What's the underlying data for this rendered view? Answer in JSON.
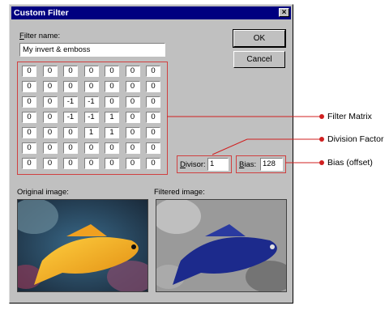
{
  "dialog": {
    "title": "Custom Filter",
    "filter_name_label": "Filter name:",
    "filter_name_value": "My invert & emboss",
    "ok_label": "OK",
    "cancel_label": "Cancel",
    "matrix": [
      [
        "0",
        "0",
        "0",
        "0",
        "0",
        "0",
        "0"
      ],
      [
        "0",
        "0",
        "0",
        "0",
        "0",
        "0",
        "0"
      ],
      [
        "0",
        "0",
        "-1",
        "-1",
        "0",
        "0",
        "0"
      ],
      [
        "0",
        "0",
        "-1",
        "-1",
        "1",
        "0",
        "0"
      ],
      [
        "0",
        "0",
        "0",
        "1",
        "1",
        "0",
        "0"
      ],
      [
        "0",
        "0",
        "0",
        "0",
        "0",
        "0",
        "0"
      ],
      [
        "0",
        "0",
        "0",
        "0",
        "0",
        "0",
        "0"
      ]
    ],
    "divisor_label": "Divisor:",
    "divisor_value": "1",
    "bias_label": "Bias:",
    "bias_value": "128",
    "original_label": "Original image:",
    "filtered_label": "Filtered image:"
  },
  "callouts": {
    "filter_matrix": "Filter Matrix",
    "division_factor": "Division Factor",
    "bias_offset": "Bias (offset)"
  },
  "colors": {
    "titlebar": "#000080",
    "callout_line": "#d02020"
  }
}
